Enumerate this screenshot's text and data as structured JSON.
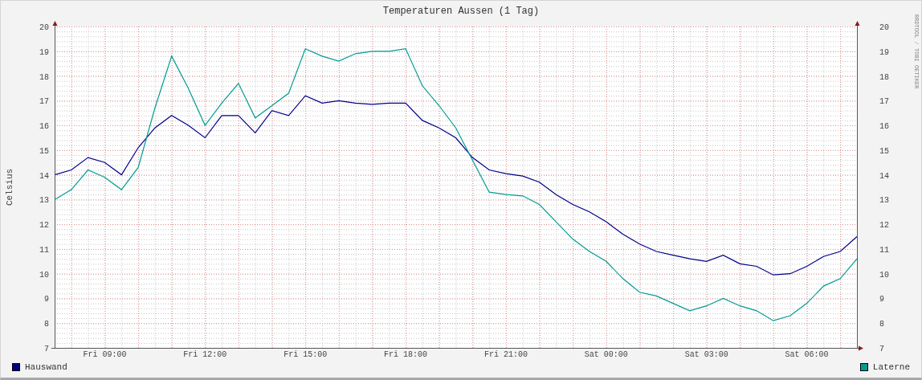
{
  "graph": {
    "chart_data": {
      "type": "line",
      "title": "Temperaturen Aussen (1 Tag)",
      "ylabel": "Celsius",
      "categories": [
        null,
        null,
        null,
        "Fri 09:00",
        null,
        null,
        null,
        null,
        null,
        "Fri 12:00",
        null,
        null,
        null,
        null,
        null,
        "Fri 15:00",
        null,
        null,
        null,
        null,
        null,
        "Fri 18:00",
        null,
        null,
        null,
        null,
        null,
        "Fri 21:00",
        null,
        null,
        null,
        null,
        null,
        "Sat 00:00",
        null,
        null,
        null,
        null,
        null,
        "Sat 03:00",
        null,
        null,
        null,
        null,
        null,
        "Sat 06:00",
        null,
        null,
        null
      ],
      "series": [
        {
          "name": "Hauswand",
          "color": "#00008b",
          "values": [
            14.0,
            14.2,
            14.7,
            14.5,
            14.0,
            15.1,
            15.9,
            16.4,
            16.0,
            15.5,
            16.4,
            16.4,
            15.7,
            16.6,
            16.4,
            17.2,
            16.9,
            17.0,
            16.9,
            16.85,
            16.9,
            16.9,
            16.2,
            15.9,
            15.5,
            14.7,
            14.2,
            14.05,
            13.95,
            13.7,
            13.2,
            12.8,
            12.5,
            12.1,
            11.6,
            11.2,
            10.9,
            10.75,
            10.6,
            10.5,
            10.75,
            10.4,
            10.3,
            9.95,
            10.0,
            10.3,
            10.7,
            10.9,
            11.5
          ]
        },
        {
          "name": "Laterne",
          "color": "#009c94",
          "values": [
            13.0,
            13.4,
            14.2,
            13.9,
            13.4,
            14.3,
            16.7,
            18.8,
            17.5,
            16.0,
            16.9,
            17.7,
            16.3,
            16.8,
            17.3,
            19.1,
            18.8,
            18.6,
            18.9,
            19.0,
            19.0,
            19.1,
            17.6,
            16.8,
            15.9,
            14.6,
            13.3,
            13.2,
            13.15,
            12.8,
            12.1,
            11.4,
            10.9,
            10.5,
            9.8,
            9.25,
            9.1,
            8.8,
            8.5,
            8.7,
            9.0,
            8.7,
            8.5,
            8.1,
            8.3,
            8.8,
            9.5,
            9.8,
            10.6
          ]
        }
      ],
      "ylim": [
        7,
        20
      ],
      "grid": true,
      "yticks": [
        7,
        8,
        9,
        10,
        11,
        12,
        13,
        14,
        15,
        16,
        17,
        18,
        19,
        20
      ]
    },
    "right_axis_labels": [
      "20",
      "19",
      "18",
      "17",
      "16",
      "15",
      "14",
      "13",
      "12",
      "11",
      "10",
      "9",
      "8",
      "7"
    ],
    "credit": "RRDTOOL / TOBI OETIKER"
  }
}
